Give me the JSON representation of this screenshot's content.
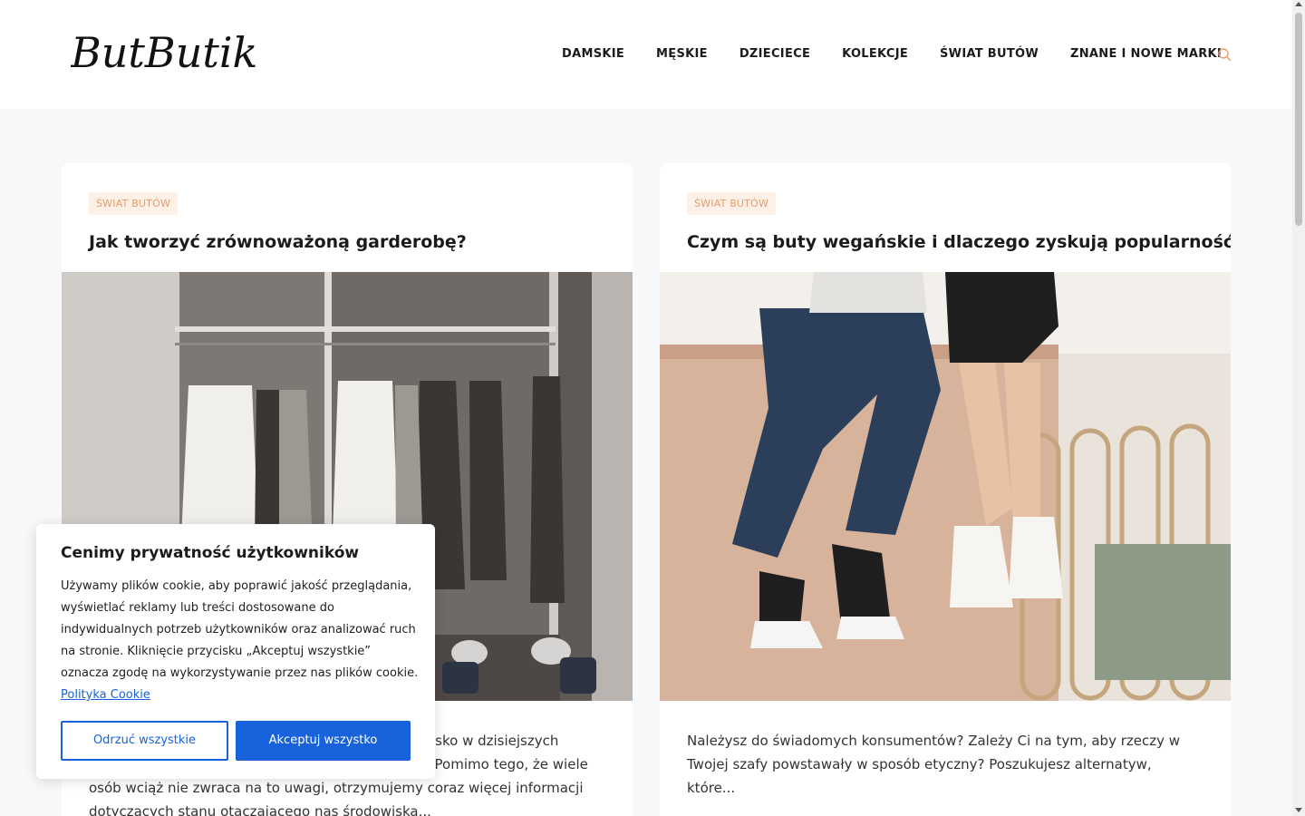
{
  "header": {
    "logo_text": "ButButik",
    "nav": [
      "DAMSKIE",
      "MĘSKIE",
      "DZIECIECE",
      "KOLEKCJE",
      "ŚWIAT BUTÓW",
      "ZNANE I NOWE MARKI"
    ],
    "search_icon": "search-icon"
  },
  "posts": [
    {
      "category": "ŚWIAT BUTÓW",
      "title": "Jak tworzyć zrównoważoną garderobę?",
      "excerpt": "Zrównoważona moda to coraz popularniejsze zjawisko w dzisiejszych czasach i nie bez powodu jest obecnie w trendzie! Pomimo tego, że wiele osób wciąż nie zwraca na to uwagi, otrzymujemy coraz więcej informacji dotyczących stanu otaczającego nas środowiska..."
    },
    {
      "category": "ŚWIAT BUTÓW",
      "title": "Czym są buty wegańskie i dlaczego zyskują popularność?",
      "excerpt": "Należysz do świadomych konsumentów? Zależy Ci na tym, aby rzeczy w Twojej szafy powstawały w sposób etyczny? Poszukujesz alternatyw, które..."
    }
  ],
  "cookie": {
    "title": "Cenimy prywatność użytkowników",
    "text": "Używamy plików cookie, aby poprawić jakość przeglądania, wyświetlać reklamy lub treści dostosowane do indywidualnych potrzeb użytkowników oraz analizować ruch na stronie. Kliknięcie przycisku „Akceptuj wszystkie” oznacza zgodę na wykorzystywanie przez nas plików cookie.",
    "link": "Polityka Cookie",
    "reject": "Odrzuć wszystkie",
    "accept": "Akceptuj wszystko"
  },
  "colors": {
    "accent": "#e89c6b",
    "badge_bg": "#fdf0e7",
    "button": "#1863dc"
  }
}
